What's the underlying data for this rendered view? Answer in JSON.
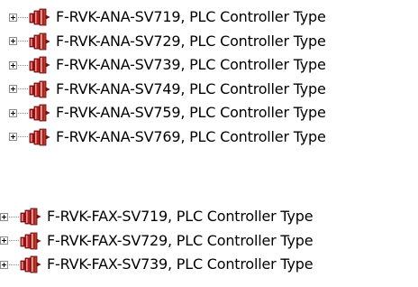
{
  "groups": [
    {
      "items": [
        {
          "label": "F-RVK-ANA-SV719, PLC Controller Type"
        },
        {
          "label": "F-RVK-ANA-SV729, PLC Controller Type"
        },
        {
          "label": "F-RVK-ANA-SV739, PLC Controller Type"
        },
        {
          "label": "F-RVK-ANA-SV749, PLC Controller Type"
        },
        {
          "label": "F-RVK-ANA-SV759, PLC Controller Type"
        },
        {
          "label": "F-RVK-ANA-SV769, PLC Controller Type"
        }
      ]
    },
    {
      "items": [
        {
          "label": "F-RVK-FAX-SV719, PLC Controller Type"
        },
        {
          "label": "F-RVK-FAX-SV729, PLC Controller Type"
        },
        {
          "label": "F-RVK-FAX-SV739, PLC Controller Type"
        }
      ]
    }
  ],
  "icons": {
    "expander": "plus-box-icon",
    "node": "plc-controller-icon"
  },
  "colors": {
    "icon_dark": "#7a1010",
    "icon_mid": "#c0392b",
    "icon_light": "#ff8a8a"
  }
}
